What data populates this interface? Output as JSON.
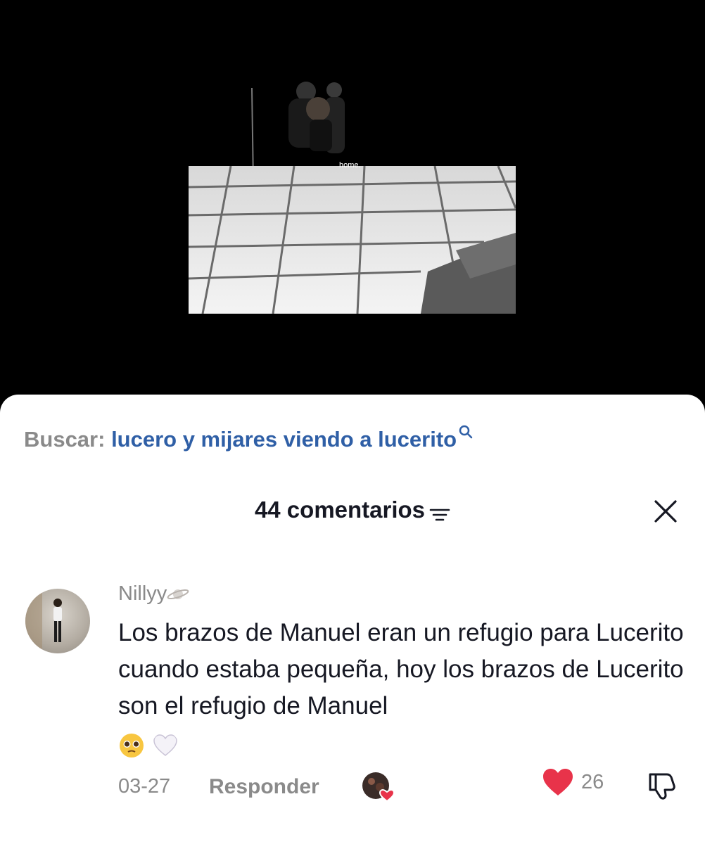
{
  "video": {
    "overlay_text": "home."
  },
  "search": {
    "label": "Buscar:",
    "query": "lucero y mijares viendo a lucerito"
  },
  "comments_panel": {
    "count_label": "44 comentarios"
  },
  "comment": {
    "username": "Nillyy",
    "text": "Los brazos de Manuel eran un refugio para Lucerito cuando estaba pequeña, hoy los brazos de Lucerito son el refugio de Manuel",
    "emojis": [
      "pleading-face-emoji",
      "white-heart-emoji"
    ],
    "date": "03-27",
    "reply_label": "Responder",
    "like_count": "26"
  },
  "colors": {
    "search_query": "#2f5fa6",
    "like_heart": "#e8334a",
    "muted_text": "#8a8a8a"
  }
}
